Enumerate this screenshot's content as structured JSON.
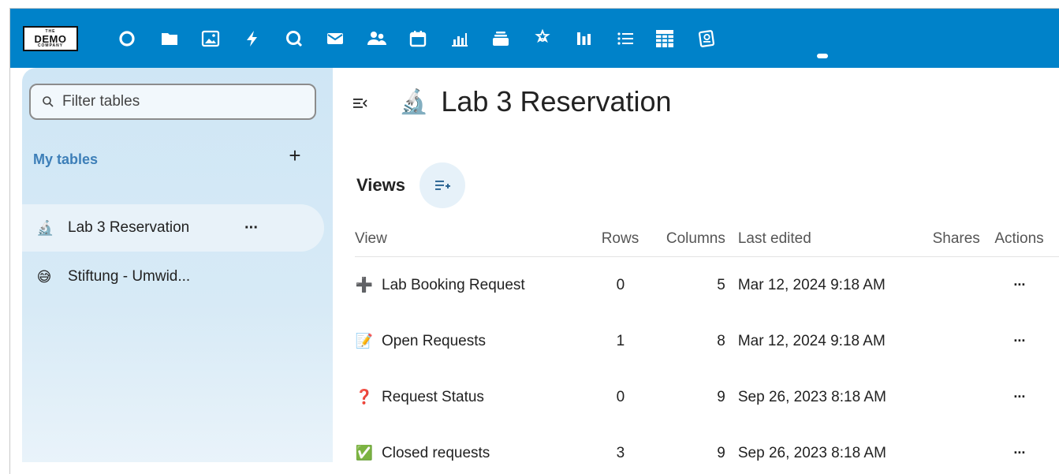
{
  "app": {
    "logo_top": "THE",
    "logo_main": "DEMO",
    "logo_bottom": "COMPANY"
  },
  "topnav": {
    "icons": [
      "dashboard-icon",
      "files-icon",
      "photos-icon",
      "activity-icon",
      "search-icon",
      "mail-icon",
      "contacts-icon",
      "calendar-icon",
      "analytics-icon",
      "deck-icon",
      "collectives-icon",
      "stats-icon",
      "tasks-icon",
      "tables-icon",
      "forms-icon"
    ],
    "active": "tables-icon",
    "colors": {
      "bar": "#0082c9",
      "icon": "#ffffff"
    }
  },
  "sidebar": {
    "search_placeholder": "Filter tables",
    "section_title": "My tables",
    "add_label": "+",
    "items": [
      {
        "emoji": "🔬",
        "label": "Lab 3 Reservation",
        "more": "···",
        "active": true
      },
      {
        "emoji": "😅",
        "label": "Stiftung - Umwid...",
        "active": false
      }
    ]
  },
  "main": {
    "title_emoji": "🔬",
    "title": "Lab 3 Reservation",
    "views_label": "Views",
    "columns": [
      "View",
      "Rows",
      "Columns",
      "Last edited",
      "Shares",
      "Actions"
    ],
    "rows": [
      {
        "emoji": "➕",
        "name": "Lab Booking Request",
        "rows": "0",
        "columns": "5",
        "edited": "Mar 12, 2024 9:18 AM",
        "actions": "···"
      },
      {
        "emoji": "📝",
        "name": "Open Requests",
        "rows": "1",
        "columns": "8",
        "edited": "Mar 12, 2024 9:18 AM",
        "actions": "···"
      },
      {
        "emoji": "❓",
        "name": "Request Status",
        "rows": "0",
        "columns": "9",
        "edited": "Sep 26, 2023 8:18 AM",
        "actions": "···"
      },
      {
        "emoji": "✅",
        "name": "Closed requests",
        "rows": "3",
        "columns": "9",
        "edited": "Sep 26, 2023 8:18 AM",
        "actions": "···"
      }
    ]
  }
}
